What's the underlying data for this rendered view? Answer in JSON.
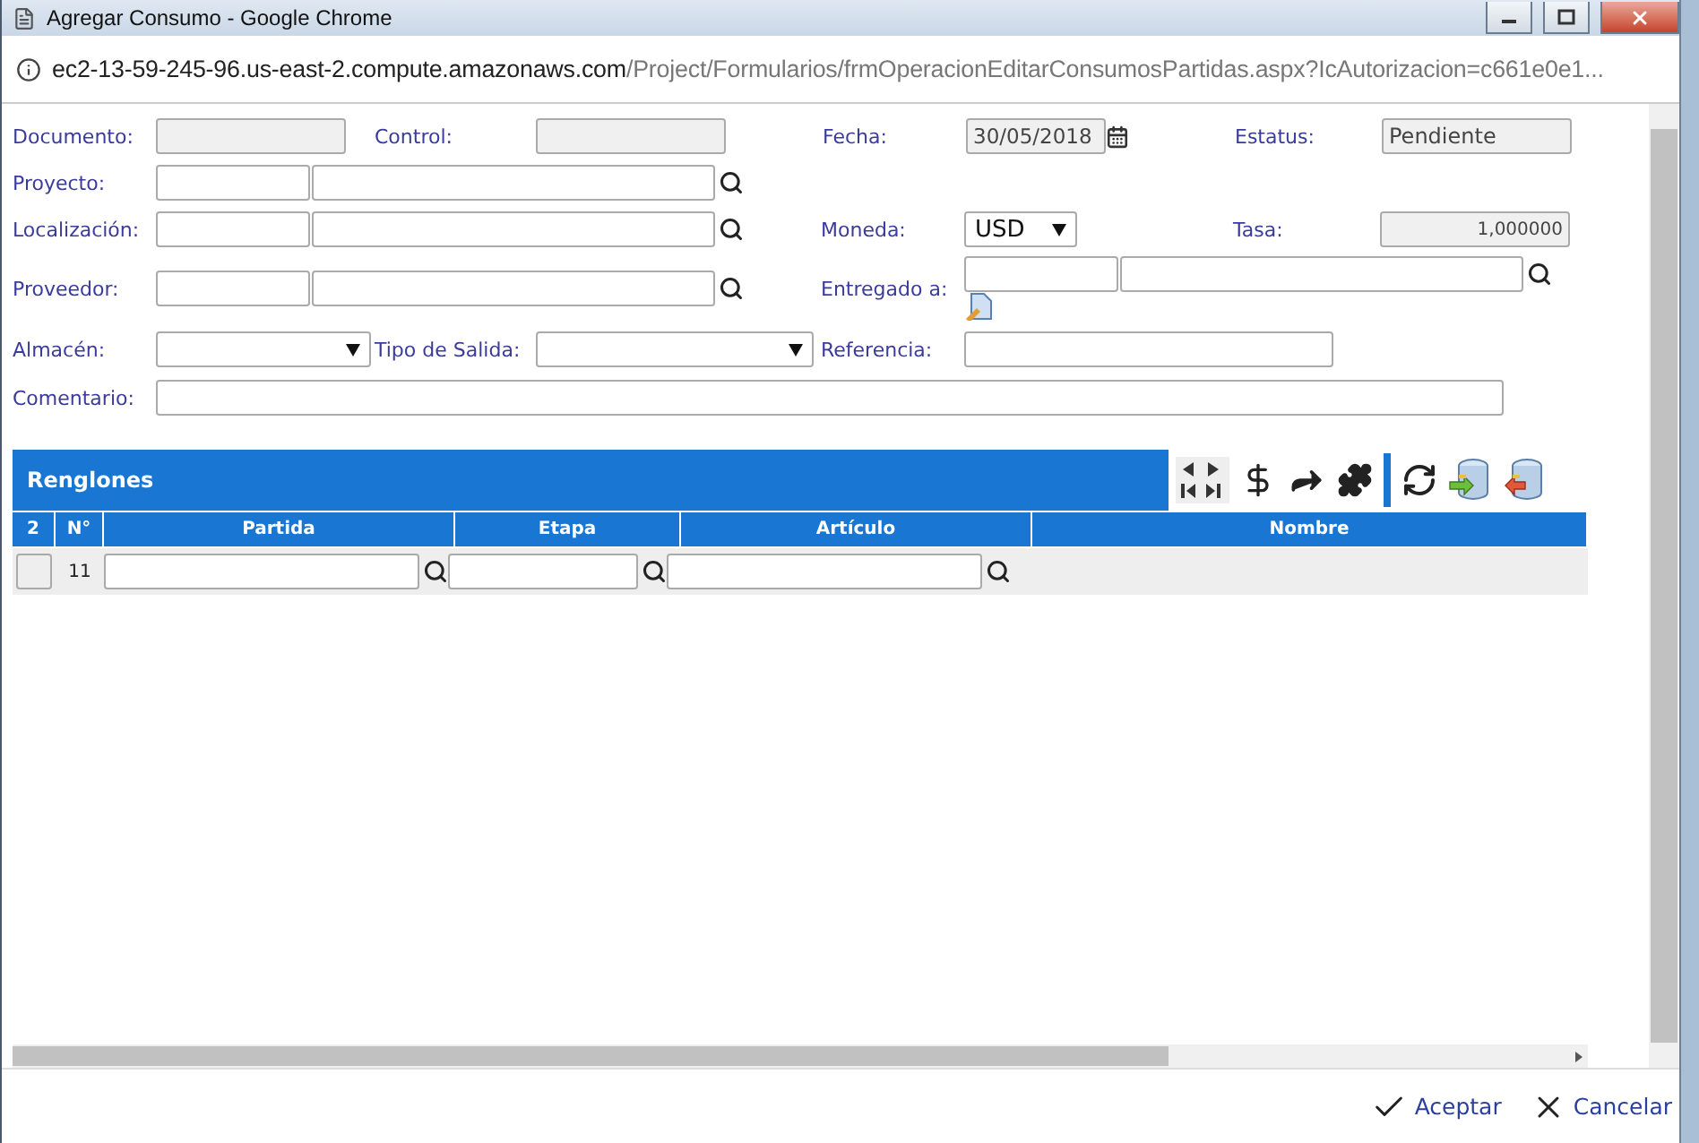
{
  "window": {
    "title": "Agregar Consumo - Google Chrome"
  },
  "address_bar": {
    "host": "ec2-13-59-245-96.us-east-2.compute.amazonaws.com",
    "path": "/Project/Formularios/frmOperacionEditarConsumosPartidas.aspx?IcAutorizacion=c661e0e1..."
  },
  "form": {
    "documento": {
      "label": "Documento:",
      "disabled": true
    },
    "control": {
      "label": "Control:",
      "disabled": true
    },
    "fecha": {
      "label": "Fecha:",
      "value": "30/05/2018",
      "disabled": true
    },
    "estatus": {
      "label": "Estatus:",
      "value": "Pendiente",
      "disabled": true
    },
    "proyecto": {
      "label": "Proyecto:",
      "disabled": false
    },
    "localizacion": {
      "label": "Localización:",
      "disabled": false
    },
    "moneda": {
      "label": "Moneda:",
      "value": "USD",
      "disabled": false
    },
    "tasa": {
      "label": "Tasa:",
      "value": "1,000000",
      "disabled": true
    },
    "proveedor": {
      "label": "Proveedor:",
      "disabled": false
    },
    "entregado_a": {
      "label": "Entregado a:",
      "disabled": false
    },
    "almacen": {
      "label": "Almacén:",
      "disabled": false
    },
    "tipo_de_salida": {
      "label": "Tipo de Salida:",
      "disabled": false
    },
    "referencia": {
      "label": "Referencia:",
      "disabled": false
    },
    "comentario": {
      "label": "Comentario:",
      "disabled": false
    }
  },
  "grid": {
    "title": "Renglones",
    "columns": [
      "2",
      "N°",
      "Partida",
      "Etapa",
      "Artículo",
      "Nombre"
    ],
    "rows": [
      {
        "number": "11"
      }
    ]
  },
  "buttons": [
    {
      "label": "Aceptar",
      "kind": "accept"
    },
    {
      "label": "Cancelar",
      "kind": "cancel"
    }
  ]
}
